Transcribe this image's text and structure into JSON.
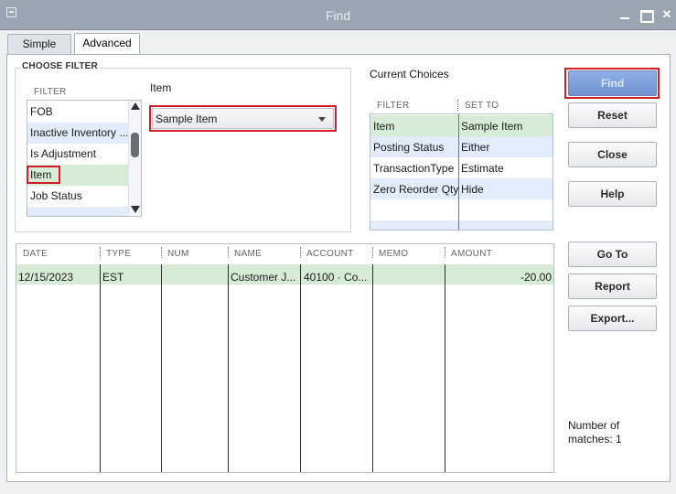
{
  "window": {
    "title": "Find"
  },
  "tabs": [
    {
      "label": "Simple"
    },
    {
      "label": "Advanced"
    }
  ],
  "choose_filter": {
    "group_label": "CHOOSE FILTER",
    "column_label": "FILTER",
    "items": [
      "FOB",
      "Inactive Inventory ...",
      "Is Adjustment",
      "Item",
      "Job Status",
      ""
    ],
    "selected": "Item"
  },
  "item_filter": {
    "label": "Item",
    "dropdown_value": "Sample Item"
  },
  "current_choices": {
    "title": "Current Choices",
    "headers": [
      "FILTER",
      "SET TO"
    ],
    "rows": [
      {
        "filter": "Item",
        "set_to": "Sample Item"
      },
      {
        "filter": "Posting Status",
        "set_to": "Either"
      },
      {
        "filter": "TransactionType",
        "set_to": "Estimate"
      },
      {
        "filter": "Zero Reorder Qty",
        "set_to": "Hide"
      }
    ]
  },
  "results": {
    "headers": [
      "DATE",
      "TYPE",
      "NUM",
      "NAME",
      "ACCOUNT",
      "MEMO",
      "AMOUNT"
    ],
    "rows": [
      {
        "date": "12/15/2023",
        "type": "EST",
        "num": "",
        "name": "Customer J...",
        "account": "40100 · Co...",
        "memo": "",
        "amount": "-20.00"
      }
    ]
  },
  "buttons": {
    "find": "Find",
    "reset": "Reset",
    "close": "Close",
    "help": "Help",
    "goto": "Go To",
    "report": "Report",
    "export": "Export..."
  },
  "matches": {
    "line1": "Number of",
    "line2": "matches: 1"
  }
}
